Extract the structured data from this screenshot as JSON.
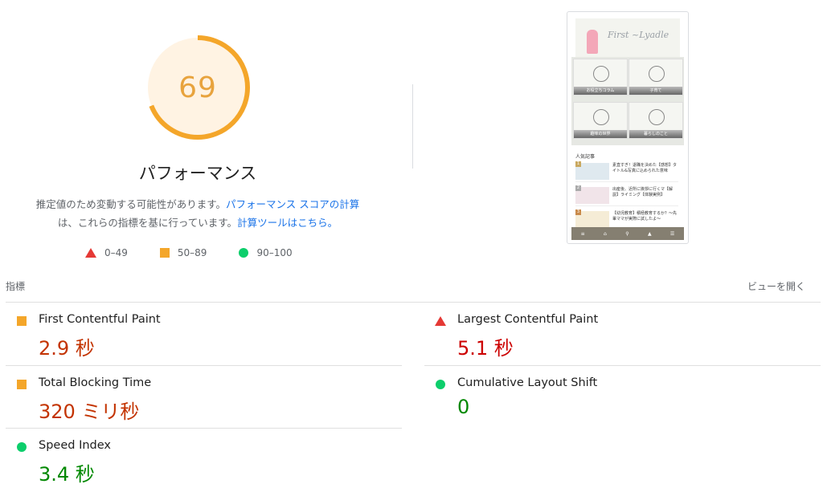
{
  "score": {
    "value": 69,
    "fraction": 0.69,
    "color": "#f4a62a",
    "bg_color": "#fff3e3"
  },
  "performance": {
    "title": "パフォーマンス",
    "desc_part1": "推定値のため変動する可能性があります。",
    "desc_link1": "パフォーマンス スコアの計算",
    "desc_part2": "は、これらの指標を基に行っています。",
    "desc_link2": "計算ツールはこちら。"
  },
  "legend": [
    {
      "icon": "red-triangle-icon",
      "label": "0–49"
    },
    {
      "icon": "orange-square-icon",
      "label": "50–89"
    },
    {
      "icon": "green-circle-icon",
      "label": "90–100"
    }
  ],
  "thumbnail": {
    "header_title": "First ~Lyadle",
    "tiles": [
      "お役立ちコラム",
      "子育て",
      "趣味の世界",
      "暮らしのこと"
    ],
    "section_title": "人気記事",
    "articles": [
      "素直すぎ！退職を決めた【感想】タイトル&写真に込められた意味",
      "出産後、近所に挨拶に行くマ【解説】ライミング【体験実例】",
      "【幼児教育】積極教育するか？〜先輩ママが実際に試したよ〜"
    ]
  },
  "metrics": {
    "label": "指標",
    "expand_label": "ビューを開く",
    "fcp": {
      "name": "First Contentful Paint",
      "value": "2.9 秒",
      "status": "orange"
    },
    "lcp": {
      "name": "Largest Contentful Paint",
      "value": "5.1 秒",
      "status": "red"
    },
    "tbt": {
      "name": "Total Blocking Time",
      "value": "320 ミリ秒",
      "status": "orange"
    },
    "cls": {
      "name": "Cumulative Layout Shift",
      "value": "0",
      "status": "green"
    },
    "si": {
      "name": "Speed Index",
      "value": "3.4 秒",
      "status": "green"
    }
  }
}
